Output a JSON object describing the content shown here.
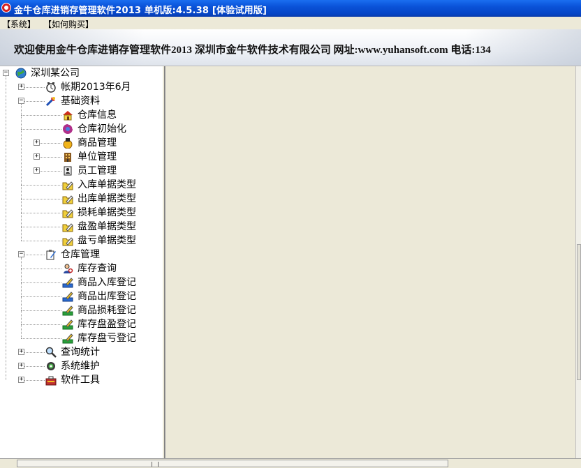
{
  "window": {
    "title": "金牛仓库进销存管理软件2013 单机版:4.5.38 [体验试用版]"
  },
  "menu": [
    {
      "label": "【系统】"
    },
    {
      "label": "【如何购买】"
    }
  ],
  "banner": {
    "text": "欢迎使用金牛仓库进销存管理软件2013 深圳市金牛软件技术有限公司 网址:www.yuhansoft.com 电话:134"
  },
  "tree": {
    "nodes": [
      {
        "label": "深圳某公司",
        "icon": "globe-icon",
        "expander": "collapse"
      },
      {
        "label": "帐期2013年6月",
        "icon": "clock-icon",
        "expander": "expand"
      },
      {
        "label": "基础资料",
        "icon": "tools-icon",
        "expander": "collapse"
      },
      {
        "label": "仓库信息",
        "icon": "house-icon",
        "expander": ""
      },
      {
        "label": "仓库初始化",
        "icon": "refresh-disc-icon",
        "expander": ""
      },
      {
        "label": "商品管理",
        "icon": "goods-icon",
        "expander": "expand"
      },
      {
        "label": "单位管理",
        "icon": "building-icon",
        "expander": "expand"
      },
      {
        "label": "员工管理",
        "icon": "employee-icon",
        "expander": "expand"
      },
      {
        "label": "入库单据类型",
        "icon": "folder-pencil-icon",
        "expander": ""
      },
      {
        "label": "出库单据类型",
        "icon": "folder-pencil-icon",
        "expander": ""
      },
      {
        "label": "损耗单据类型",
        "icon": "folder-pencil-icon",
        "expander": ""
      },
      {
        "label": "盘盈单据类型",
        "icon": "folder-pencil-icon",
        "expander": ""
      },
      {
        "label": "盘亏单据类型",
        "icon": "folder-pencil-icon",
        "expander": ""
      },
      {
        "label": "仓库管理",
        "icon": "clipboard-pen-icon",
        "expander": "collapse"
      },
      {
        "label": "库存查询",
        "icon": "person-search-icon",
        "expander": ""
      },
      {
        "label": "商品入库登记",
        "icon": "pen-tray-blue-icon",
        "expander": ""
      },
      {
        "label": "商品出库登记",
        "icon": "pen-tray-blue-icon",
        "expander": ""
      },
      {
        "label": "商品损耗登记",
        "icon": "pen-tray-green-icon",
        "expander": ""
      },
      {
        "label": "库存盘盈登记",
        "icon": "pen-tray-green-icon",
        "expander": ""
      },
      {
        "label": "库存盘亏登记",
        "icon": "pen-tray-green-icon",
        "expander": ""
      },
      {
        "label": "查询统计",
        "icon": "magnifier-icon",
        "expander": "expand"
      },
      {
        "label": "系统维护",
        "icon": "gear-icon",
        "expander": "expand"
      },
      {
        "label": "软件工具",
        "icon": "toolbox-icon",
        "expander": "expand"
      }
    ]
  },
  "colors": {
    "title_bar": "#0a52d8",
    "main_bg": "#ece9d8",
    "tree_bg": "#ffffff"
  }
}
